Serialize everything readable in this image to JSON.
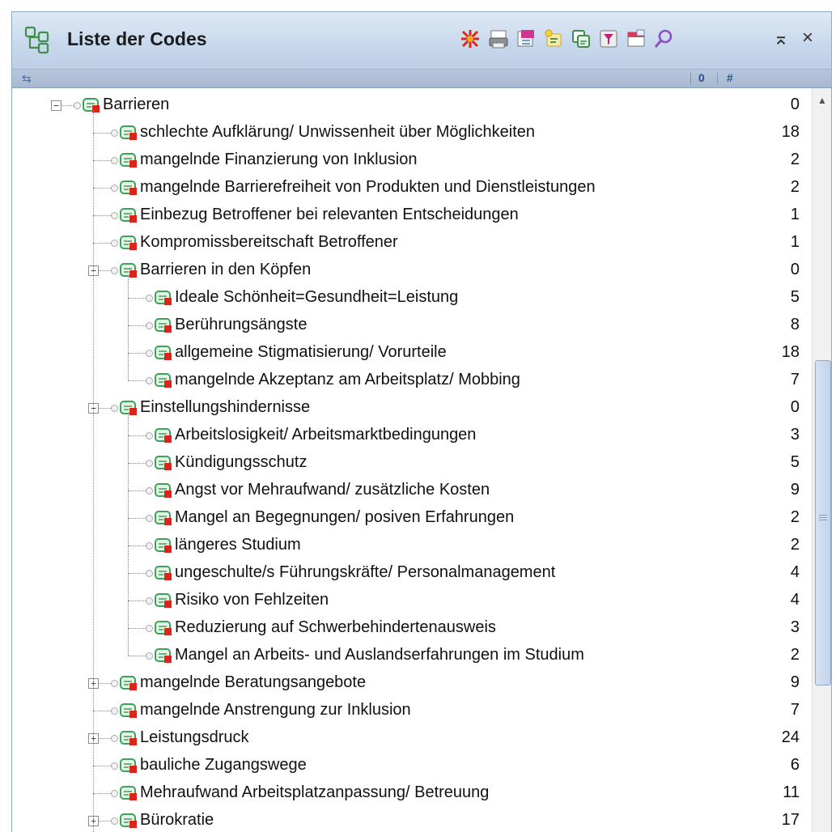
{
  "window": {
    "title": "Liste der Codes",
    "colors": {
      "title_gradient_top": "#dfe9f5",
      "header_bar": "#a6b9d2",
      "code_icon_green": "#3aa35a",
      "code_icon_red": "#d9261c"
    }
  },
  "toolbar": {
    "buttons": [
      "activate-all-icon",
      "print-icon",
      "export-icon",
      "new-code-icon",
      "code-set-icon",
      "filter-icon",
      "window-icon",
      "search-icon"
    ],
    "window_controls": {
      "pin": "⌅",
      "close": "×"
    }
  },
  "header": {
    "columns": [
      "0",
      "#"
    ]
  },
  "tree": {
    "rows": [
      {
        "label": "Barrieren",
        "count": "0",
        "level": 0,
        "expander": "minus"
      },
      {
        "label": "schlechte Aufklärung/ Unwissenheit über Möglichkeiten",
        "count": "18",
        "level": 1,
        "expander": ""
      },
      {
        "label": "mangelnde Finanzierung von Inklusion",
        "count": "2",
        "level": 1,
        "expander": ""
      },
      {
        "label": "mangelnde Barrierefreiheit von Produkten und Dienstleistungen",
        "count": "2",
        "level": 1,
        "expander": ""
      },
      {
        "label": "Einbezug Betroffener bei relevanten Entscheidungen",
        "count": "1",
        "level": 1,
        "expander": ""
      },
      {
        "label": "Kompromissbereitschaft Betroffener",
        "count": "1",
        "level": 1,
        "expander": ""
      },
      {
        "label": "Barrieren in den Köpfen",
        "count": "0",
        "level": 1,
        "expander": "minus"
      },
      {
        "label": "Ideale Schönheit=Gesundheit=Leistung",
        "count": "5",
        "level": 2,
        "expander": ""
      },
      {
        "label": "Berührungsängste",
        "count": "8",
        "level": 2,
        "expander": ""
      },
      {
        "label": "allgemeine Stigmatisierung/ Vorurteile",
        "count": "18",
        "level": 2,
        "expander": ""
      },
      {
        "label": "mangelnde Akzeptanz am Arbeitsplatz/ Mobbing",
        "count": "7",
        "level": 2,
        "expander": ""
      },
      {
        "label": "Einstellungshindernisse",
        "count": "0",
        "level": 1,
        "expander": "minus"
      },
      {
        "label": "Arbeitslosigkeit/ Arbeitsmarktbedingungen",
        "count": "3",
        "level": 2,
        "expander": ""
      },
      {
        "label": "Kündigungsschutz",
        "count": "5",
        "level": 2,
        "expander": ""
      },
      {
        "label": "Angst vor Mehraufwand/ zusätzliche Kosten",
        "count": "9",
        "level": 2,
        "expander": ""
      },
      {
        "label": "Mangel an Begegnungen/ posiven Erfahrungen",
        "count": "2",
        "level": 2,
        "expander": ""
      },
      {
        "label": "längeres Studium",
        "count": "2",
        "level": 2,
        "expander": ""
      },
      {
        "label": "ungeschulte/s Führungskräfte/ Personalmanagement",
        "count": "4",
        "level": 2,
        "expander": ""
      },
      {
        "label": "Risiko von Fehlzeiten",
        "count": "4",
        "level": 2,
        "expander": ""
      },
      {
        "label": "Reduzierung auf Schwerbehindertenausweis",
        "count": "3",
        "level": 2,
        "expander": ""
      },
      {
        "label": "Mangel an Arbeits- und Auslandserfahrungen im Studium",
        "count": "2",
        "level": 2,
        "expander": ""
      },
      {
        "label": "mangelnde Beratungsangebote",
        "count": "9",
        "level": 1,
        "expander": "plus"
      },
      {
        "label": "mangelnde Anstrengung zur Inklusion",
        "count": "7",
        "level": 1,
        "expander": ""
      },
      {
        "label": "Leistungsdruck",
        "count": "24",
        "level": 1,
        "expander": "plus"
      },
      {
        "label": "bauliche Zugangswege",
        "count": "6",
        "level": 1,
        "expander": ""
      },
      {
        "label": "Mehraufwand Arbeitsplatzanpassung/ Betreuung",
        "count": "11",
        "level": 1,
        "expander": ""
      },
      {
        "label": "Bürokratie",
        "count": "17",
        "level": 1,
        "expander": "plus"
      }
    ]
  },
  "scrollbar": {
    "position_fraction": 0.37,
    "thumb_fraction": 0.44
  }
}
